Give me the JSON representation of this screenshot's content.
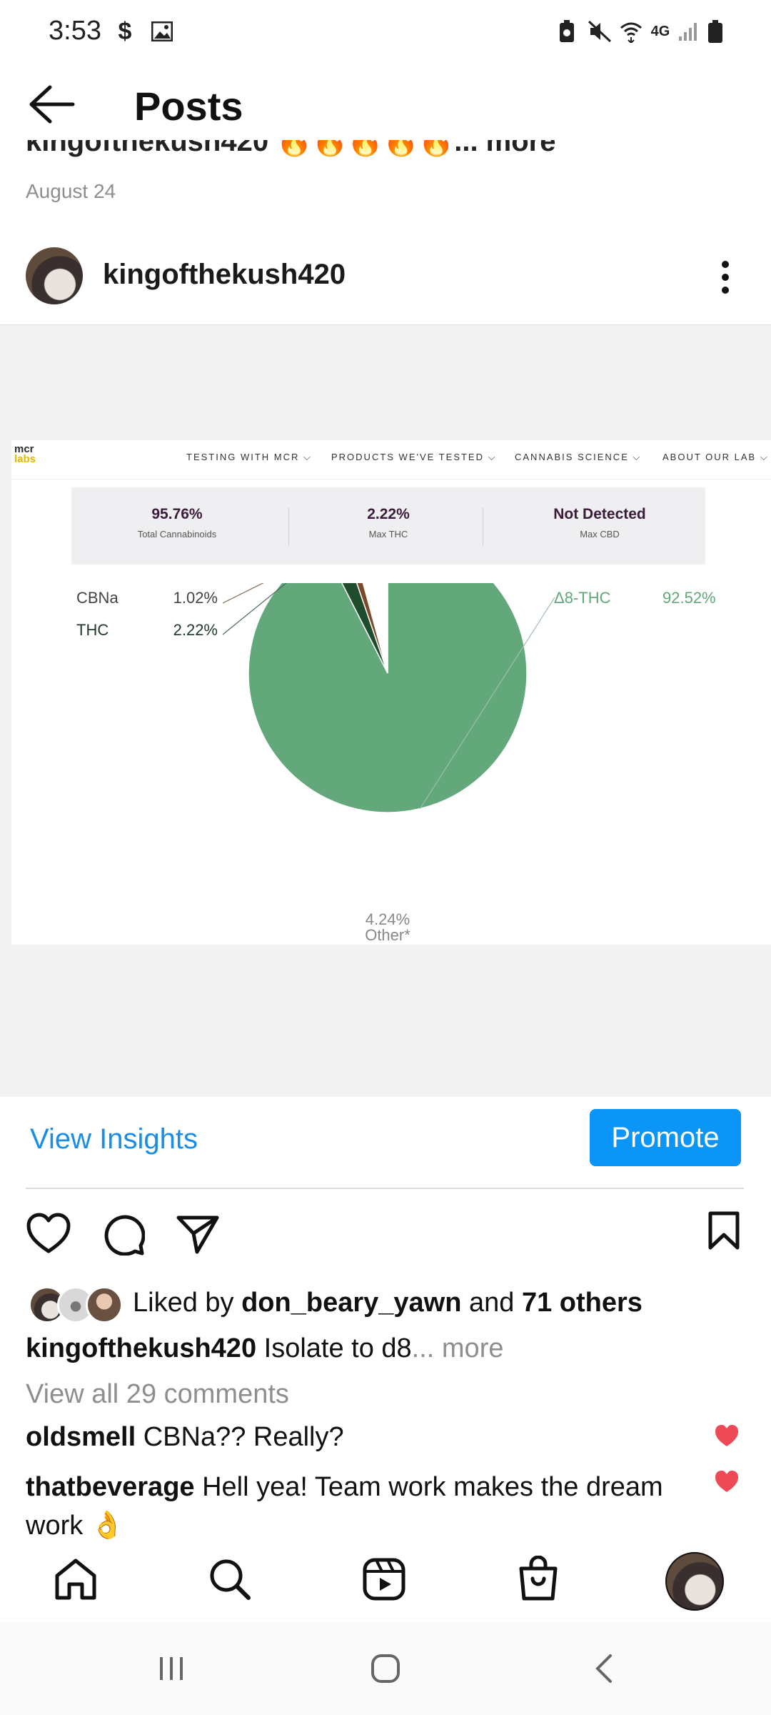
{
  "status_bar": {
    "time": "3:53",
    "left_icons": [
      "dollar-sign-icon",
      "image-icon"
    ],
    "right_icons": [
      "battery-saver-icon",
      "mute-icon",
      "wifi-icon",
      "network-4g-icon",
      "signal-icon",
      "battery-icon"
    ],
    "network_label": "4G"
  },
  "header": {
    "title": "Posts"
  },
  "previous_post": {
    "caption_fragment": "kingofthekush420 🔥🔥🔥🔥🔥... more",
    "date": "August 24"
  },
  "post": {
    "username": "kingofthekush420",
    "image": {
      "logo_line1": "mcr",
      "logo_line2": "labs",
      "nav": [
        "TESTING WITH MCR ⌵",
        "PRODUCTS WE'VE TESTED ⌵",
        "CANNABIS SCIENCE ⌵",
        "ABOUT OUR LAB ⌵"
      ],
      "stats": [
        {
          "value": "95.76%",
          "label": "Total Cannabinoids"
        },
        {
          "value": "2.22%",
          "label": "Max THC"
        },
        {
          "value": "Not Detected",
          "label": "Max CBD"
        }
      ]
    },
    "view_insights": "View Insights",
    "promote": "Promote",
    "likes": {
      "prefix": "Liked by ",
      "user": "don_beary_yawn",
      "middle": " and ",
      "count": "71 others"
    },
    "caption": {
      "user": "kingofthekush420",
      "text": " Isolate to d8",
      "more": "... more"
    },
    "view_comments": "View all 29 comments",
    "comments": [
      {
        "user": "oldsmell",
        "text": " CBNa?? Really?"
      },
      {
        "user": "thatbeverage",
        "text": " Hell yea! Team work makes the dream work 👌"
      }
    ]
  },
  "colors": {
    "accent": "#0b95f6",
    "link": "#1b8de6",
    "heart": "#ed4956",
    "pie_main": "#62a87a"
  },
  "bottom_nav": [
    "home-icon",
    "search-icon",
    "reels-icon",
    "shop-icon",
    "profile-avatar"
  ],
  "chart_data": {
    "type": "pie",
    "series": [
      {
        "name": "Δ8-THC",
        "value": 92.52,
        "label": "92.52%",
        "color": "#62a87a"
      },
      {
        "name": "THC",
        "value": 2.22,
        "label": "2.22%",
        "color": "#1f4d2b"
      },
      {
        "name": "CBNa",
        "value": 1.02,
        "label": "1.02%",
        "color": "#7a4a2a"
      },
      {
        "name": "Other*",
        "value": 4.24,
        "label": "4.24%",
        "color": "#ffffff"
      }
    ],
    "legend": "labels-with-leader-lines"
  }
}
